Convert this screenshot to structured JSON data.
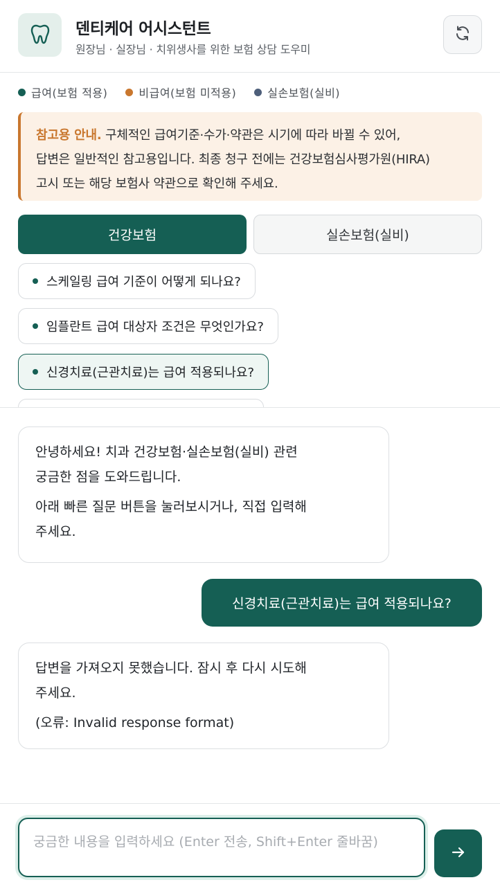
{
  "header": {
    "title": "덴티케어 어시스턴트",
    "subtitle": "원장님 · 실장님 · 치위생사를 위한 보험 상담 도우미",
    "logo_icon": "tooth-icon",
    "refresh_icon": "refresh-icon"
  },
  "legend": [
    {
      "label": "급여(보험 적용)",
      "color": "#155f54"
    },
    {
      "label": "비급여(보험 미적용)",
      "color": "#c9772e"
    },
    {
      "label": "실손보험(실비)",
      "color": "#4e5f7a"
    }
  ],
  "notice": {
    "title": "참고용 안내.",
    "line1": " 구체적인 급여기준·수가·약관은 시기에 따라 바뀔 수 있어,",
    "line2": "답변은 일반적인 참고용입니다. 최종 청구 전에는 건강보험심사평가원(HIRA)",
    "line3": "고시 또는 해당 보험사 약관으로 확인해 주세요."
  },
  "tabs": [
    {
      "label": "건강보험",
      "active": true
    },
    {
      "label": "실손보험(실비)",
      "active": false
    }
  ],
  "quick_questions": [
    {
      "label": "스케일링 급여 기준이 어떻게 되나요?"
    },
    {
      "label": "임플란트 급여 대상자 조건은 무엇인가요?"
    },
    {
      "label": "신경치료(근관치료)는 급여 적용되나요?"
    },
    {
      "label": ""
    }
  ],
  "messages": {
    "welcome_line1": "안녕하세요! 치과 건강보험·실손보험(실비) 관련",
    "welcome_line2": "궁금한 점을 도와드립니다.",
    "welcome_line3": "아래 빠른 질문 버튼을 눌러보시거나, 직접 입력해",
    "welcome_line4": "주세요.",
    "user_question": "신경치료(근관치료)는 급여 적용되나요?",
    "error_line1": "답변을 가져오지 못했습니다. 잠시 후 다시 시도해",
    "error_line2": "주세요.",
    "error_detail": "(오류: Invalid response format)"
  },
  "input": {
    "placeholder": "궁금한 내용을 입력하세요 (Enter 전송, Shift+Enter 줄바꿈)",
    "value": "",
    "send_icon": "arrow-right-icon"
  },
  "colors": {
    "brand": "#155f54",
    "accent": "#c9772e",
    "notice_bg": "#fcf1e6"
  }
}
